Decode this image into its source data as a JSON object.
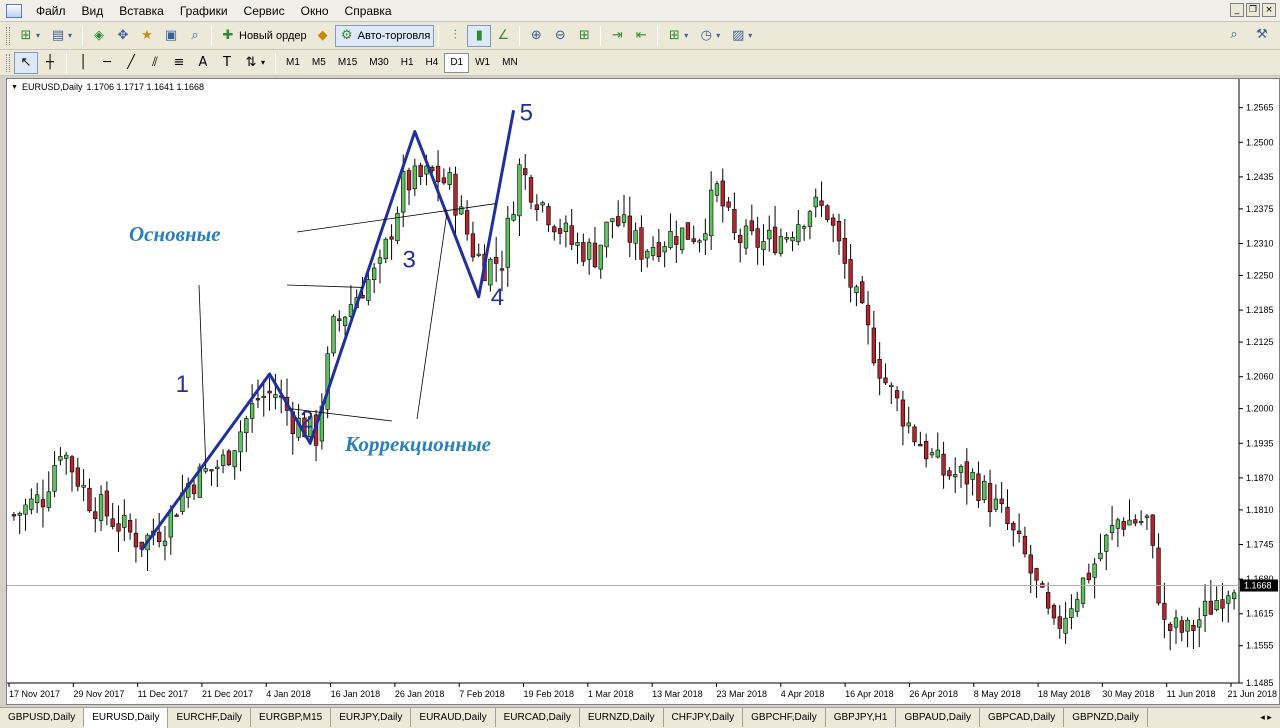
{
  "menu": {
    "items": [
      "Файл",
      "Вид",
      "Вставка",
      "Графики",
      "Сервис",
      "Окно",
      "Справка"
    ]
  },
  "toolbar": {
    "new_order_label": "Новый ордер",
    "autotrade_label": "Авто-торговля"
  },
  "timeframes": [
    "M1",
    "M5",
    "M15",
    "M30",
    "H1",
    "H4",
    "D1",
    "W1",
    "MN"
  ],
  "active_timeframe": "D1",
  "chart": {
    "header_symbol": "EURUSD,Daily",
    "header_ohlc": "1.1706 1.1717 1.1641 1.1668",
    "current_price_label": "1.1668",
    "annotations": {
      "main_label": "Основные",
      "correction_label": "Коррекционные",
      "wave_labels": [
        "1",
        "2",
        "3",
        "4",
        "5"
      ]
    }
  },
  "chart_data": {
    "type": "candlestick",
    "y_ticks": [
      "1.2565",
      "1.2500",
      "1.2435",
      "1.2375",
      "1.2310",
      "1.2250",
      "1.2185",
      "1.2125",
      "1.2060",
      "1.2000",
      "1.1935",
      "1.1870",
      "1.1810",
      "1.1745",
      "1.1680",
      "1.1615",
      "1.1555",
      "1.1485"
    ],
    "ylim": [
      1.1485,
      1.2585
    ],
    "x_ticks": [
      "17 Nov 2017",
      "29 Nov 2017",
      "11 Dec 2017",
      "21 Dec 2017",
      "4 Jan 2018",
      "16 Jan 2018",
      "26 Jan 2018",
      "7 Feb 2018",
      "19 Feb 2018",
      "1 Mar 2018",
      "13 Mar 2018",
      "23 Mar 2018",
      "4 Apr 2018",
      "16 Apr 2018",
      "26 Apr 2018",
      "8 May 2018",
      "18 May 2018",
      "30 May 2018",
      "11 Jun 2018",
      "21 Jun 2018"
    ],
    "current_price": 1.1668,
    "up_color": "#5cc25c",
    "down_color": "#b2272d",
    "wave_color": "#1f2f9e",
    "label_color": "#2a7fc0",
    "close_keypoints": [
      [
        0,
        1.18
      ],
      [
        5,
        1.1835
      ],
      [
        8,
        1.193
      ],
      [
        13,
        1.183
      ],
      [
        20,
        1.1765
      ],
      [
        22,
        1.175
      ],
      [
        26,
        1.178
      ],
      [
        30,
        1.186
      ],
      [
        36,
        1.19
      ],
      [
        42,
        1.202
      ],
      [
        45,
        1.203
      ],
      [
        48,
        1.198
      ],
      [
        52,
        1.195
      ],
      [
        55,
        1.215
      ],
      [
        60,
        1.223
      ],
      [
        63,
        1.226
      ],
      [
        67,
        1.242
      ],
      [
        72,
        1.244
      ],
      [
        75,
        1.242
      ],
      [
        79,
        1.23
      ],
      [
        81,
        1.227
      ],
      [
        84,
        1.228
      ],
      [
        87,
        1.245
      ],
      [
        90,
        1.24
      ],
      [
        96,
        1.231
      ],
      [
        100,
        1.229
      ],
      [
        103,
        1.236
      ],
      [
        108,
        1.23
      ],
      [
        114,
        1.233
      ],
      [
        118,
        1.233
      ],
      [
        121,
        1.241
      ],
      [
        124,
        1.232
      ],
      [
        129,
        1.231
      ],
      [
        133,
        1.233
      ],
      [
        137,
        1.238
      ],
      [
        140,
        1.237
      ],
      [
        145,
        1.22
      ],
      [
        150,
        1.205
      ],
      [
        155,
        1.195
      ],
      [
        160,
        1.188
      ],
      [
        165,
        1.187
      ],
      [
        170,
        1.18
      ],
      [
        174,
        1.172
      ],
      [
        179,
        1.158
      ],
      [
        182,
        1.164
      ],
      [
        186,
        1.171
      ],
      [
        190,
        1.179
      ],
      [
        195,
        1.179
      ],
      [
        198,
        1.159
      ],
      [
        202,
        1.158
      ],
      [
        206,
        1.163
      ],
      [
        210,
        1.168
      ]
    ],
    "waves": {
      "impulse": [
        [
          22,
          1.1735
        ],
        [
          44,
          1.2065
        ],
        [
          51,
          1.1935
        ],
        [
          69,
          1.252
        ],
        [
          80,
          1.221
        ],
        [
          86,
          1.256
        ]
      ],
      "corrective_shown": "2, 4"
    }
  },
  "tabs": [
    "GBPUSD,Daily",
    "EURUSD,Daily",
    "EURCHF,Daily",
    "EURGBP,M15",
    "EURJPY,Daily",
    "EURAUD,Daily",
    "EURCAD,Daily",
    "EURNZD,Daily",
    "CHFJPY,Daily",
    "GBPCHF,Daily",
    "GBPJPY,H1",
    "GBPAUD,Daily",
    "GBPCAD,Daily",
    "GBPNZD,Daily"
  ],
  "active_tab": "EURUSD,Daily",
  "icons": {
    "search": "magnifier",
    "settings": "tools"
  }
}
